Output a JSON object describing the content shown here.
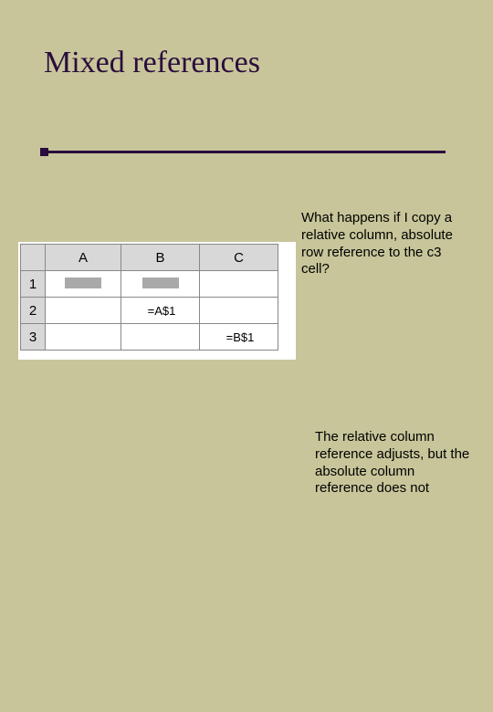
{
  "title": "Mixed references",
  "question": "What happens if I copy a relative column, absolute row reference to the c3 cell?",
  "answer": "The relative column reference adjusts, but the absolute column reference does not",
  "sheet": {
    "col_headers": [
      "A",
      "B",
      "C"
    ],
    "row_headers": [
      "1",
      "2",
      "3"
    ],
    "cells": {
      "A1_placeholder": true,
      "B1_placeholder": true,
      "B2": "=A$1",
      "C3": "=B$1"
    }
  }
}
